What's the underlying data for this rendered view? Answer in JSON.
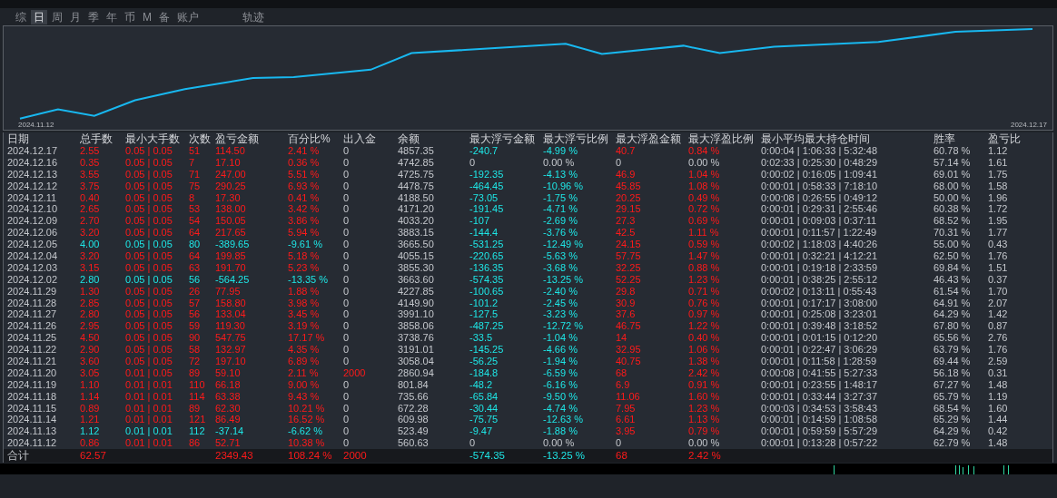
{
  "tabs": [
    {
      "label": "综",
      "selected": false
    },
    {
      "label": "日",
      "selected": true
    },
    {
      "label": "周",
      "selected": false
    },
    {
      "label": "月",
      "selected": false
    },
    {
      "label": "季",
      "selected": false
    },
    {
      "label": "年",
      "selected": false
    },
    {
      "label": "币",
      "selected": false
    },
    {
      "label": "M",
      "selected": false
    },
    {
      "label": "备",
      "selected": false
    },
    {
      "label": "账户",
      "selected": false
    }
  ],
  "trace_tab": {
    "label": "轨迹",
    "selected": false
  },
  "equity_chart": {
    "start_label": "2024.11.12",
    "end_label": "2024.12.17"
  },
  "table": {
    "columns": [
      "日期",
      "总手数",
      "最小大手数",
      "次数",
      "盈亏金额",
      "百分比%",
      "出入金",
      "余额",
      "最大浮亏金额",
      "最大浮亏比例",
      "最大浮盈金额",
      "最大浮盈比例",
      "最小平均最大持仓时间",
      "胜率",
      "盈亏比"
    ],
    "rows": [
      {
        "loss": false,
        "cashflow": false,
        "floating": true,
        "cells": [
          "2024.12.17",
          "2.55",
          "0.05 | 0.05",
          "51",
          "114.50",
          "2.41 %",
          "0",
          "4857.35",
          "-240.7",
          "-4.99 %",
          "40.7",
          "0.84 %",
          "0:00:04 | 1:06:33 | 5:32:48",
          "60.78 %",
          "1.12"
        ]
      },
      {
        "loss": false,
        "cashflow": false,
        "floating": false,
        "cells": [
          "2024.12.16",
          "0.35",
          "0.05 | 0.05",
          "7",
          "17.10",
          "0.36 %",
          "0",
          "4742.85",
          "0",
          "0.00 %",
          "0",
          "0.00 %",
          "0:02:33 | 0:25:30 | 0:48:29",
          "57.14 %",
          "1.61"
        ]
      },
      {
        "loss": false,
        "cashflow": false,
        "floating": true,
        "cells": [
          "2024.12.13",
          "3.55",
          "0.05 | 0.05",
          "71",
          "247.00",
          "5.51 %",
          "0",
          "4725.75",
          "-192.35",
          "-4.13 %",
          "46.9",
          "1.04 %",
          "0:00:02 | 0:16:05 | 1:09:41",
          "69.01 %",
          "1.75"
        ]
      },
      {
        "loss": false,
        "cashflow": false,
        "floating": true,
        "cells": [
          "2024.12.12",
          "3.75",
          "0.05 | 0.05",
          "75",
          "290.25",
          "6.93 %",
          "0",
          "4478.75",
          "-464.45",
          "-10.96 %",
          "45.85",
          "1.08 %",
          "0:00:01 | 0:58:33 | 7:18:10",
          "68.00 %",
          "1.58"
        ]
      },
      {
        "loss": false,
        "cashflow": false,
        "floating": true,
        "cells": [
          "2024.12.11",
          "0.40",
          "0.05 | 0.05",
          "8",
          "17.30",
          "0.41 %",
          "0",
          "4188.50",
          "-73.05",
          "-1.75 %",
          "20.25",
          "0.49 %",
          "0:00:08 | 0:26:55 | 0:49:12",
          "50.00 %",
          "1.96"
        ]
      },
      {
        "loss": false,
        "cashflow": false,
        "floating": true,
        "cells": [
          "2024.12.10",
          "2.65",
          "0.05 | 0.05",
          "53",
          "138.00",
          "3.42 %",
          "0",
          "4171.20",
          "-191.45",
          "-4.71 %",
          "29.15",
          "0.72 %",
          "0:00:01 | 0:29:31 | 2:55:46",
          "60.38 %",
          "1.72"
        ]
      },
      {
        "loss": false,
        "cashflow": false,
        "floating": true,
        "cells": [
          "2024.12.09",
          "2.70",
          "0.05 | 0.05",
          "54",
          "150.05",
          "3.86 %",
          "0",
          "4033.20",
          "-107",
          "-2.69 %",
          "27.3",
          "0.69 %",
          "0:00:01 | 0:09:03 | 0:37:11",
          "68.52 %",
          "1.95"
        ]
      },
      {
        "loss": false,
        "cashflow": false,
        "floating": true,
        "cells": [
          "2024.12.06",
          "3.20",
          "0.05 | 0.05",
          "64",
          "217.65",
          "5.94 %",
          "0",
          "3883.15",
          "-144.4",
          "-3.76 %",
          "42.5",
          "1.11 %",
          "0:00:01 | 0:11:57 | 1:22:49",
          "70.31 %",
          "1.77"
        ]
      },
      {
        "loss": true,
        "cashflow": false,
        "floating": true,
        "cells": [
          "2024.12.05",
          "4.00",
          "0.05 | 0.05",
          "80",
          "-389.65",
          "-9.61 %",
          "0",
          "3665.50",
          "-531.25",
          "-12.49 %",
          "24.15",
          "0.59 %",
          "0:00:02 | 1:18:03 | 4:40:26",
          "55.00 %",
          "0.43"
        ]
      },
      {
        "loss": false,
        "cashflow": false,
        "floating": true,
        "cells": [
          "2024.12.04",
          "3.20",
          "0.05 | 0.05",
          "64",
          "199.85",
          "5.18 %",
          "0",
          "4055.15",
          "-220.65",
          "-5.63 %",
          "57.75",
          "1.47 %",
          "0:00:01 | 0:32:21 | 4:12:21",
          "62.50 %",
          "1.76"
        ]
      },
      {
        "loss": false,
        "cashflow": false,
        "floating": true,
        "cells": [
          "2024.12.03",
          "3.15",
          "0.05 | 0.05",
          "63",
          "191.70",
          "5.23 %",
          "0",
          "3855.30",
          "-136.35",
          "-3.68 %",
          "32.25",
          "0.88 %",
          "0:00:01 | 0:19:18 | 2:33:59",
          "69.84 %",
          "1.51"
        ]
      },
      {
        "loss": true,
        "cashflow": false,
        "floating": true,
        "cells": [
          "2024.12.02",
          "2.80",
          "0.05 | 0.05",
          "56",
          "-564.25",
          "-13.35 %",
          "0",
          "3663.60",
          "-574.35",
          "-13.25 %",
          "52.25",
          "1.23 %",
          "0:00:01 | 0:38:25 | 2:55:12",
          "46.43 %",
          "0.37"
        ]
      },
      {
        "loss": false,
        "cashflow": false,
        "floating": true,
        "cells": [
          "2024.11.29",
          "1.30",
          "0.05 | 0.05",
          "26",
          "77.95",
          "1.88 %",
          "0",
          "4227.85",
          "-100.65",
          "-2.40 %",
          "29.8",
          "0.71 %",
          "0:00:02 | 0:13:11 | 0:55:43",
          "61.54 %",
          "1.70"
        ]
      },
      {
        "loss": false,
        "cashflow": false,
        "floating": true,
        "cells": [
          "2024.11.28",
          "2.85",
          "0.05 | 0.05",
          "57",
          "158.80",
          "3.98 %",
          "0",
          "4149.90",
          "-101.2",
          "-2.45 %",
          "30.9",
          "0.76 %",
          "0:00:01 | 0:17:17 | 3:08:00",
          "64.91 %",
          "2.07"
        ]
      },
      {
        "loss": false,
        "cashflow": false,
        "floating": true,
        "cells": [
          "2024.11.27",
          "2.80",
          "0.05 | 0.05",
          "56",
          "133.04",
          "3.45 %",
          "0",
          "3991.10",
          "-127.5",
          "-3.23 %",
          "37.6",
          "0.97 %",
          "0:00:01 | 0:25:08 | 3:23:01",
          "64.29 %",
          "1.42"
        ]
      },
      {
        "loss": false,
        "cashflow": false,
        "floating": true,
        "cells": [
          "2024.11.26",
          "2.95",
          "0.05 | 0.05",
          "59",
          "119.30",
          "3.19 %",
          "0",
          "3858.06",
          "-487.25",
          "-12.72 %",
          "46.75",
          "1.22 %",
          "0:00:01 | 0:39:48 | 3:18:52",
          "67.80 %",
          "0.87"
        ]
      },
      {
        "loss": false,
        "cashflow": false,
        "floating": true,
        "cells": [
          "2024.11.25",
          "4.50",
          "0.05 | 0.05",
          "90",
          "547.75",
          "17.17 %",
          "0",
          "3738.76",
          "-33.5",
          "-1.04 %",
          "14",
          "0.40 %",
          "0:00:01 | 0:01:15 | 0:12:20",
          "65.56 %",
          "2.76"
        ]
      },
      {
        "loss": false,
        "cashflow": false,
        "floating": true,
        "cells": [
          "2024.11.22",
          "2.90",
          "0.05 | 0.05",
          "58",
          "132.97",
          "4.35 %",
          "0",
          "3191.01",
          "-145.25",
          "-4.66 %",
          "32.95",
          "1.06 %",
          "0:00:01 | 0:22:47 | 3:06:29",
          "63.79 %",
          "1.76"
        ]
      },
      {
        "loss": false,
        "cashflow": false,
        "floating": true,
        "cells": [
          "2024.11.21",
          "3.60",
          "0.05 | 0.05",
          "72",
          "197.10",
          "6.89 %",
          "0",
          "3058.04",
          "-56.25",
          "-1.94 %",
          "40.75",
          "1.38 %",
          "0:00:01 | 0:11:58 | 1:28:59",
          "69.44 %",
          "2.59"
        ]
      },
      {
        "loss": false,
        "cashflow": true,
        "floating": true,
        "cells": [
          "2024.11.20",
          "3.05",
          "0.01 | 0.05",
          "89",
          "59.10",
          "2.11 %",
          "2000",
          "2860.94",
          "-184.8",
          "-6.59 %",
          "68",
          "2.42 %",
          "0:00:08 | 0:41:55 | 5:27:33",
          "56.18 %",
          "0.31"
        ]
      },
      {
        "loss": false,
        "cashflow": false,
        "floating": true,
        "cells": [
          "2024.11.19",
          "1.10",
          "0.01 | 0.01",
          "110",
          "66.18",
          "9.00 %",
          "0",
          "801.84",
          "-48.2",
          "-6.16 %",
          "6.9",
          "0.91 %",
          "0:00:01 | 0:23:55 | 1:48:17",
          "67.27 %",
          "1.48"
        ]
      },
      {
        "loss": false,
        "cashflow": false,
        "floating": true,
        "cells": [
          "2024.11.18",
          "1.14",
          "0.01 | 0.01",
          "114",
          "63.38",
          "9.43 %",
          "0",
          "735.66",
          "-65.84",
          "-9.50 %",
          "11.06",
          "1.60 %",
          "0:00:01 | 0:33:44 | 3:27:37",
          "65.79 %",
          "1.19"
        ]
      },
      {
        "loss": false,
        "cashflow": false,
        "floating": true,
        "cells": [
          "2024.11.15",
          "0.89",
          "0.01 | 0.01",
          "89",
          "62.30",
          "10.21 %",
          "0",
          "672.28",
          "-30.44",
          "-4.74 %",
          "7.95",
          "1.23 %",
          "0:00:03 | 0:34:53 | 3:58:43",
          "68.54 %",
          "1.60"
        ]
      },
      {
        "loss": false,
        "cashflow": false,
        "floating": true,
        "cells": [
          "2024.11.14",
          "1.21",
          "0.01 | 0.01",
          "121",
          "86.49",
          "16.52 %",
          "0",
          "609.98",
          "-75.75",
          "-12.63 %",
          "6.61",
          "1.13 %",
          "0:00:01 | 0:14:59 | 1:08:58",
          "65.29 %",
          "1.44"
        ]
      },
      {
        "loss": true,
        "cashflow": false,
        "floating": true,
        "cells": [
          "2024.11.13",
          "1.12",
          "0.01 | 0.01",
          "112",
          "-37.14",
          "-6.62 %",
          "0",
          "523.49",
          "-9.47",
          "-1.88 %",
          "3.95",
          "0.79 %",
          "0:00:01 | 0:59:59 | 5:57:29",
          "64.29 %",
          "0.42"
        ]
      },
      {
        "loss": false,
        "cashflow": false,
        "floating": false,
        "cells": [
          "2024.11.12",
          "0.86",
          "0.01 | 0.01",
          "86",
          "52.71",
          "10.38 %",
          "0",
          "560.63",
          "0",
          "0.00 %",
          "0",
          "0.00 %",
          "0:00:01 | 0:13:28 | 0:57:22",
          "62.79 %",
          "1.48"
        ]
      }
    ],
    "total": {
      "label": "合计",
      "lots": "62.57",
      "profit": "2349.43",
      "percent": "108.24 %",
      "cashflow": "2000",
      "max_drawdown": "-574.35",
      "max_drawdown_pct": "-13.25 %",
      "max_float_profit": "68",
      "max_float_profit_pct": "2.42 %"
    }
  }
}
